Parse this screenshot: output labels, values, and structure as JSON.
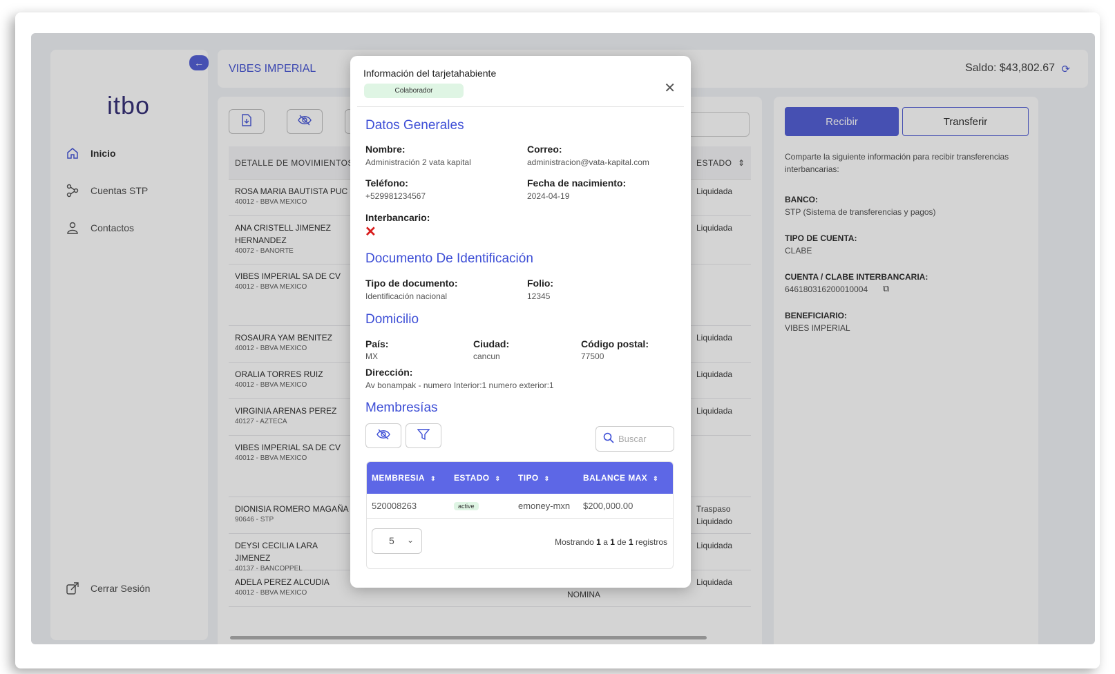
{
  "sidebar": {
    "logo": "itbo",
    "logo_subtitle": "",
    "items": [
      {
        "label": "Inicio",
        "active": true
      },
      {
        "label": "Cuentas STP",
        "active": false
      },
      {
        "label": "Contactos",
        "active": false
      }
    ],
    "logout_label": "Cerrar Sesión"
  },
  "header": {
    "title": "VIBES IMPERIAL",
    "balance": "Saldo: $43,802.67"
  },
  "main": {
    "columns": {
      "detalle": "DETALLE DE MOVIMIENTOS",
      "estado": "ESTADO"
    },
    "rows": [
      {
        "name": "ROSA MARIA BAUTISTA PUC",
        "bank": "40012 - BBVA MEXICO",
        "status": "Liquidada",
        "extra": ""
      },
      {
        "name": "ANA CRISTELL JIMENEZ HERNANDEZ",
        "bank": "40072 - BANORTE",
        "status": "Liquidada",
        "extra": ""
      },
      {
        "name": "VIBES IMPERIAL SA DE CV",
        "bank": "40012 - BBVA MEXICO",
        "status": "",
        "extra": ""
      },
      {
        "name": "ROSAURA YAM BENITEZ",
        "bank": "40012 - BBVA MEXICO",
        "status": "Liquidada",
        "extra": ""
      },
      {
        "name": "ORALIA TORRES RUIZ",
        "bank": "40012 - BBVA MEXICO",
        "status": "Liquidada",
        "extra": ""
      },
      {
        "name": "VIRGINIA ARENAS PEREZ",
        "bank": "40127 - AZTECA",
        "status": "Liquidada",
        "extra": ""
      },
      {
        "name": "VIBES IMPERIAL SA DE CV",
        "bank": "40012 - BBVA MEXICO",
        "status": "",
        "extra": ""
      },
      {
        "name": "DIONISIA ROMERO MAGAÑA",
        "bank": "90646 - STP",
        "status": "Traspaso Liquidado",
        "extra": ""
      },
      {
        "name": "DEYSI CECILIA LARA JIMENEZ",
        "bank": "40137 - BANCOPPEL",
        "status": "Liquidada",
        "extra": ""
      },
      {
        "name": "ADELA PEREZ ALCUDIA",
        "bank": "40012 - BBVA MEXICO",
        "status": "Liquidada",
        "extra": "NOMINA"
      }
    ]
  },
  "right_panel": {
    "btn_recibir": "Recibir",
    "btn_transferir": "Transferir",
    "intro": "Comparte la siguiente información para recibir transferencias interbancarias:",
    "banco_label": "BANCO:",
    "banco_value": "STP (Sistema de transferencias y pagos)",
    "tipo_label": "TIPO DE CUENTA:",
    "tipo_value": "CLABE",
    "clabe_label": "CUENTA / CLABE INTERBANCARIA:",
    "clabe_value": "646180316200010004",
    "benef_label": "BENEFICIARIO:",
    "benef_value": "VIBES IMPERIAL"
  },
  "modal": {
    "title": "Información del tarjetahabiente",
    "role_badge": "Colaborador",
    "generales": {
      "title": "Datos Generales",
      "nombre_label": "Nombre:",
      "nombre_value": "Administración 2 vata kapital",
      "correo_label": "Correo:",
      "correo_value": "administracion@vata-kapital.com",
      "telefono_label": "Teléfono:",
      "telefono_value": "+529981234567",
      "nacimiento_label": "Fecha de nacimiento:",
      "nacimiento_value": "2024-04-19",
      "interbancario_label": "Interbancario:",
      "interbancario_value": "✕"
    },
    "documento": {
      "title": "Documento De Identificación",
      "tipo_label": "Tipo de documento:",
      "tipo_value": "Identificación nacional",
      "folio_label": "Folio:",
      "folio_value": "12345"
    },
    "domicilio": {
      "title": "Domicilio",
      "pais_label": "País:",
      "pais_value": "MX",
      "ciudad_label": "Ciudad:",
      "ciudad_value": "cancun",
      "cp_label": "Código postal:",
      "cp_value": "77500",
      "direccion_label": "Dirección:",
      "direccion_value": "Av bonampak - numero Interior:1 numero exterior:1"
    },
    "membresias": {
      "title": "Membresías",
      "search_placeholder": "Buscar",
      "columns": {
        "membresia": "MEMBRESIA",
        "estado": "ESTADO",
        "tipo": "TIPO",
        "balance": "BALANCE MAX"
      },
      "row": {
        "membresia": "520008263",
        "estado": "active",
        "tipo": "emoney-mxn",
        "balance": "$200,000.00"
      },
      "page_size": "5",
      "showing_prefix": "Mostrando",
      "showing_from": "1",
      "showing_a": "a",
      "showing_to": "1",
      "showing_de": "de",
      "showing_total": "1",
      "showing_suffix": "registros"
    }
  },
  "colors": {
    "accent": "#4a56d4",
    "table_header": "#5d67e6",
    "error": "#d81b1b",
    "success_bg": "#dff5e4"
  }
}
